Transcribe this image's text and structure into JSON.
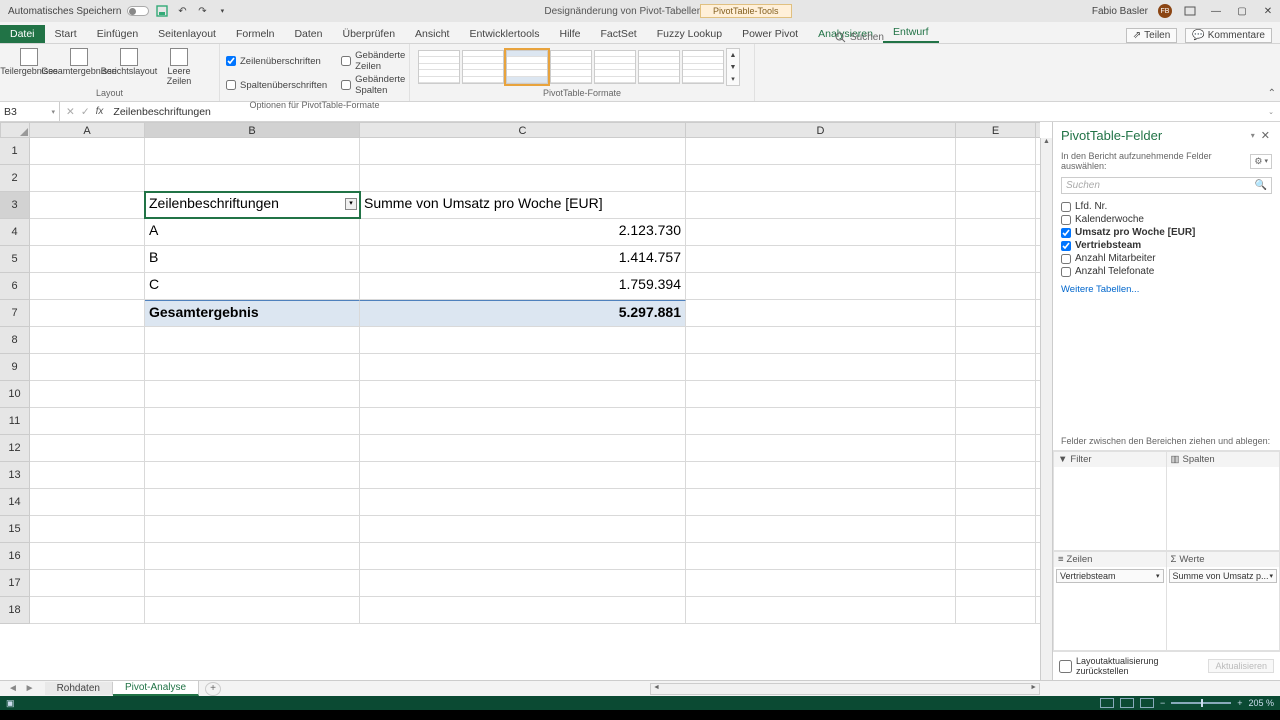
{
  "titlebar": {
    "autosave_label": "Automatisches Speichern",
    "doc_title": "Designänderung von Pivot-Tabellen - Excel",
    "context_tool": "PivotTable-Tools",
    "user_name": "Fabio Basler",
    "user_initials": "FB"
  },
  "tabs": {
    "file": "Datei",
    "items": [
      "Start",
      "Einfügen",
      "Seitenlayout",
      "Formeln",
      "Daten",
      "Überprüfen",
      "Ansicht",
      "Entwicklertools",
      "Hilfe",
      "FactSet",
      "Fuzzy Lookup",
      "Power Pivot",
      "Analysieren",
      "Entwurf"
    ],
    "active": "Entwurf",
    "search": "Suchen",
    "share": "Teilen",
    "comments": "Kommentare"
  },
  "ribbon": {
    "group1": {
      "btn1": "Teilergebnisse",
      "btn2": "Gesamtergebnisse",
      "btn3": "Berichtslayout",
      "btn4": "Leere Zeilen",
      "label": "Layout"
    },
    "group2": {
      "chk1": "Zeilenüberschriften",
      "chk2": "Gebänderte Zeilen",
      "chk3": "Spaltenüberschriften",
      "chk4": "Gebänderte Spalten",
      "label": "Optionen für PivotTable-Formate"
    },
    "group3": {
      "label": "PivotTable-Formate"
    }
  },
  "formula": {
    "cellref": "B3",
    "value": "Zeilenbeschriftungen"
  },
  "columns": {
    "A": "A",
    "B": "B",
    "C": "C",
    "D": "D",
    "E": "E"
  },
  "rows": [
    "1",
    "2",
    "3",
    "4",
    "5",
    "6",
    "7",
    "8",
    "9",
    "10",
    "11",
    "12",
    "13",
    "14",
    "15",
    "16",
    "17",
    "18"
  ],
  "pivot": {
    "row_label_header": "Zeilenbeschriftungen",
    "value_header": "Summe von Umsatz pro Woche [EUR]",
    "rows": [
      {
        "label": "A",
        "value": "2.123.730"
      },
      {
        "label": "B",
        "value": "1.414.757"
      },
      {
        "label": "C",
        "value": "1.759.394"
      }
    ],
    "total_label": "Gesamtergebnis",
    "total_value": "5.297.881"
  },
  "pane": {
    "title": "PivotTable-Felder",
    "subtitle": "In den Bericht aufzunehmende Felder auswählen:",
    "search_placeholder": "Suchen",
    "fields": [
      {
        "label": "Lfd. Nr.",
        "checked": false
      },
      {
        "label": "Kalenderwoche",
        "checked": false
      },
      {
        "label": "Umsatz pro Woche [EUR]",
        "checked": true
      },
      {
        "label": "Vertriebsteam",
        "checked": true
      },
      {
        "label": "Anzahl Mitarbeiter",
        "checked": false
      },
      {
        "label": "Anzahl Telefonate",
        "checked": false
      }
    ],
    "more_tables": "Weitere Tabellen...",
    "drag_label": "Felder zwischen den Bereichen ziehen und ablegen:",
    "area_filter": "Filter",
    "area_columns": "Spalten",
    "area_rows": "Zeilen",
    "area_values": "Werte",
    "chip_rows": "Vertriebsteam",
    "chip_values": "Summe von Umsatz p...",
    "defer_label": "Layoutaktualisierung zurückstellen",
    "update_btn": "Aktualisieren"
  },
  "sheets": {
    "tab1": "Rohdaten",
    "tab2": "Pivot-Analyse"
  },
  "status": {
    "zoom": "205 %"
  },
  "colwidths": {
    "A": 115,
    "B": 215,
    "C": 326,
    "D": 270,
    "E": 80
  }
}
